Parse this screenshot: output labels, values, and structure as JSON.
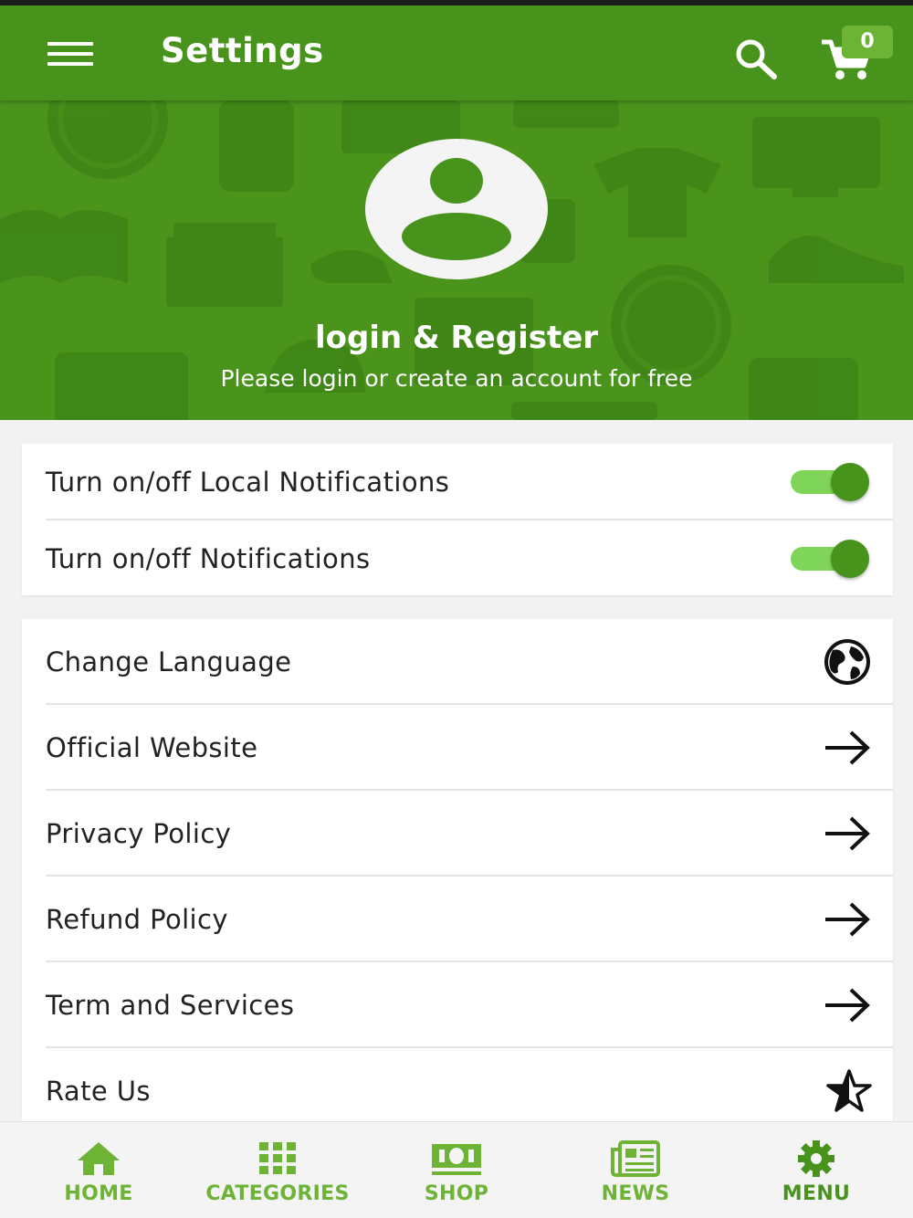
{
  "colors": {
    "primary": "#47931b",
    "accent": "#6cb336",
    "toggle_track": "#7fd45a",
    "background": "#f2f2f2"
  },
  "appbar": {
    "title": "Settings",
    "cart_count": "0",
    "icons": [
      "menu-icon",
      "search-icon",
      "cart-icon"
    ]
  },
  "hero": {
    "title": "login & Register",
    "subtitle": "Please login or create an account for free",
    "icon": "user-avatar-icon"
  },
  "notifications": [
    {
      "label": "Turn on/off Local Notifications",
      "enabled": true
    },
    {
      "label": "Turn on/off Notifications",
      "enabled": true
    }
  ],
  "menu": [
    {
      "label": "Change Language",
      "icon": "globe-icon"
    },
    {
      "label": "Official Website",
      "icon": "arrow-right-icon"
    },
    {
      "label": "Privacy Policy",
      "icon": "arrow-right-icon"
    },
    {
      "label": "Refund Policy",
      "icon": "arrow-right-icon"
    },
    {
      "label": "Term and Services",
      "icon": "arrow-right-icon"
    },
    {
      "label": "Rate Us",
      "icon": "star-icon"
    }
  ],
  "bottom_nav": [
    {
      "label": "HOME",
      "icon": "home-icon"
    },
    {
      "label": "CATEGORIES",
      "icon": "grid-icon"
    },
    {
      "label": "SHOP",
      "icon": "banknote-icon"
    },
    {
      "label": "NEWS",
      "icon": "newspaper-icon"
    },
    {
      "label": "MENU",
      "icon": "gear-icon",
      "active": true
    }
  ]
}
